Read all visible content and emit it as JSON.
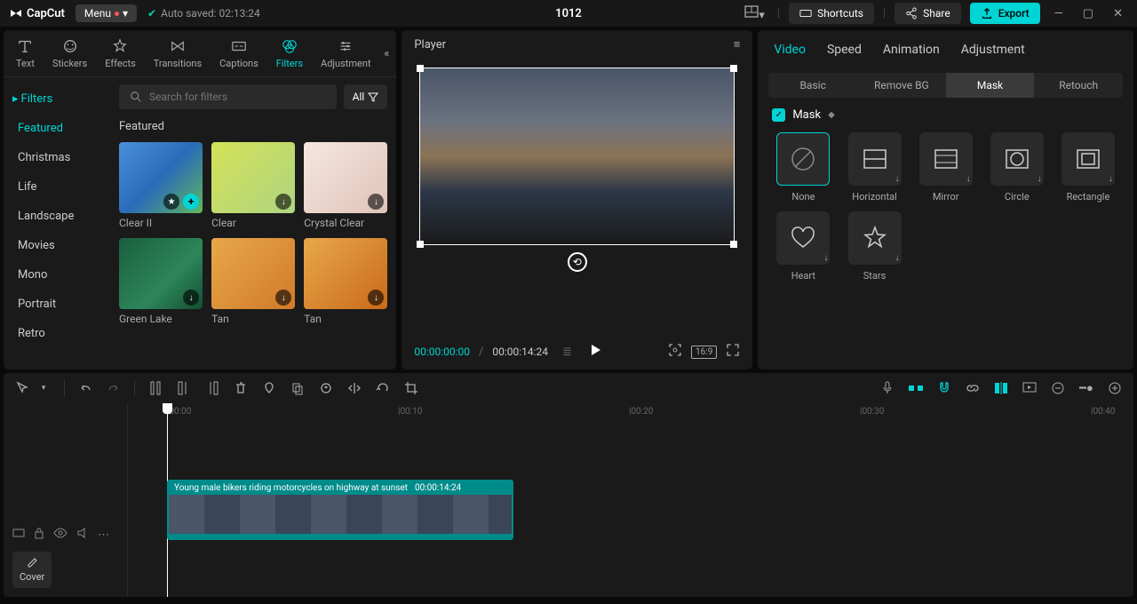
{
  "app": {
    "name": "CapCut"
  },
  "topbar": {
    "menu": "Menu",
    "autosave": "Auto saved: 02:13:24",
    "project_title": "1012",
    "shortcuts": "Shortcuts",
    "share": "Share",
    "export": "Export"
  },
  "tool_tabs": [
    {
      "label": "Text"
    },
    {
      "label": "Stickers"
    },
    {
      "label": "Effects"
    },
    {
      "label": "Transitions"
    },
    {
      "label": "Captions"
    },
    {
      "label": "Filters",
      "active": true
    },
    {
      "label": "Adjustment"
    }
  ],
  "filters": {
    "header": "Filters",
    "search_placeholder": "Search for filters",
    "all_label": "All",
    "categories": [
      {
        "label": "Featured",
        "active": true
      },
      {
        "label": "Christmas"
      },
      {
        "label": "Life"
      },
      {
        "label": "Landscape"
      },
      {
        "label": "Movies"
      },
      {
        "label": "Mono"
      },
      {
        "label": "Portrait"
      },
      {
        "label": "Retro"
      }
    ],
    "section_title": "Featured",
    "items": [
      {
        "name": "Clear II",
        "bg": "linear-gradient(135deg,#4a90d9 0%,#2a6bb8 50%,#5fb85f 100%)"
      },
      {
        "name": "Clear",
        "bg": "linear-gradient(135deg,#d4e157 0%,#aed581 100%)"
      },
      {
        "name": "Crystal Clear",
        "bg": "linear-gradient(135deg,#f5e6e0 0%,#e0c4b8 100%)"
      },
      {
        "name": "Green Lake",
        "bg": "linear-gradient(135deg,#1a5f3f 0%,#2d8659 60%,#134e33 100%)"
      },
      {
        "name": "Tan",
        "bg": "linear-gradient(135deg,#e8a74a 0%,#d17a2a 100%)"
      },
      {
        "name": "Tan",
        "bg": "linear-gradient(135deg,#e8a74a 0%,#c96a1a 100%)"
      }
    ]
  },
  "player": {
    "title": "Player",
    "timecode_current": "00:00:00:00",
    "timecode_duration": "00:00:14:24",
    "ratio": "16:9"
  },
  "right_panel": {
    "tabs": [
      {
        "label": "Video",
        "active": true
      },
      {
        "label": "Speed"
      },
      {
        "label": "Animation"
      },
      {
        "label": "Adjustment"
      }
    ],
    "subtabs": [
      {
        "label": "Basic"
      },
      {
        "label": "Remove BG"
      },
      {
        "label": "Mask",
        "active": true
      },
      {
        "label": "Retouch"
      }
    ],
    "mask_label": "Mask",
    "mask_shapes": [
      {
        "name": "None",
        "active": true
      },
      {
        "name": "Horizontal"
      },
      {
        "name": "Mirror"
      },
      {
        "name": "Circle"
      },
      {
        "name": "Rectangle"
      },
      {
        "name": "Heart"
      },
      {
        "name": "Stars"
      }
    ]
  },
  "timeline": {
    "clip_title": "Young male bikers riding motorcycles on highway at sunset",
    "clip_duration": "00:00:14:24",
    "cover_label": "Cover",
    "ruler": [
      "|00:00",
      "|00:10",
      "|00:20",
      "|00:30",
      "|00:40"
    ]
  }
}
